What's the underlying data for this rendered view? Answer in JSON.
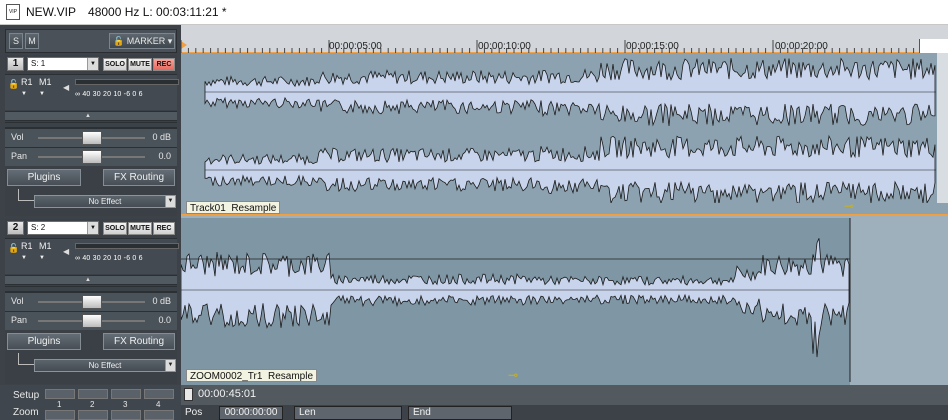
{
  "title_bar": {
    "filename": "NEW.VIP",
    "info": "48000 Hz L: 00:03:11:21 *"
  },
  "header": {
    "solo_all": "S",
    "mute_all": "M",
    "marker": "MARKER"
  },
  "ruler": {
    "ticks": [
      "00:00:05:00",
      "00:00:10:00",
      "00:00:15:00",
      "00:00:20:00"
    ]
  },
  "tracks": [
    {
      "number": "1",
      "input": "S: 1",
      "solo": "SOLO",
      "mute": "MUTE",
      "rec": "REC",
      "routing_r": "R1",
      "routing_m": "M1",
      "meter_scale": "∞ 40 30 20 10 -6 0 6",
      "vol_label": "Vol",
      "vol_value": "0 dB",
      "pan_label": "Pan",
      "pan_value": "0.0",
      "plugins_label": "Plugins",
      "fx_routing_label": "FX Routing",
      "effect": "No Effect",
      "clip_name": "Track01",
      "clip_mode": "Resample"
    },
    {
      "number": "2",
      "input": "S: 2",
      "solo": "SOLO",
      "mute": "MUTE",
      "rec": "REC",
      "routing_r": "R1",
      "routing_m": "M1",
      "meter_scale": "∞ 40 30 20 10 -6 0 6",
      "vol_label": "Vol",
      "vol_value": "0 dB",
      "pan_label": "Pan",
      "pan_value": "0.0",
      "plugins_label": "Plugins",
      "fx_routing_label": "FX Routing",
      "effect": "No Effect",
      "clip_name": "ZOOM0002_Tr1",
      "clip_mode": "Resample"
    }
  ],
  "bottom": {
    "setup_label": "Setup",
    "zoom_label": "Zoom",
    "zoom_presets": [
      "1",
      "2",
      "3",
      "4"
    ],
    "time_readout": "00:00:45:01"
  },
  "status": {
    "pos_label": "Pos",
    "pos_value": "00:00:00:00",
    "len_label": "Len",
    "end_label": "End"
  },
  "colors": {
    "accent": "#f0a040",
    "waveform_fill": "#c8d4ec",
    "rec_button": "#e8685c"
  }
}
